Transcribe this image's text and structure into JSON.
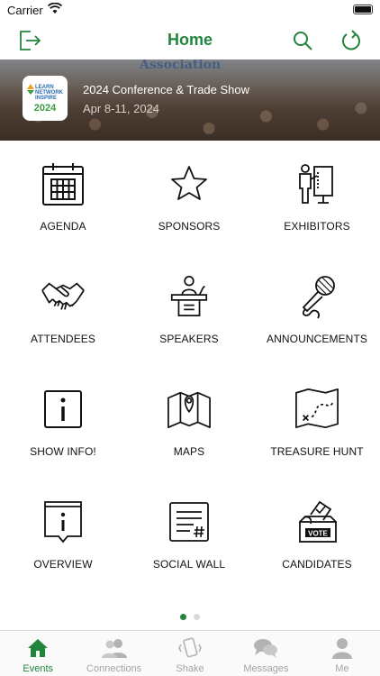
{
  "status": {
    "carrier": "Carrier"
  },
  "nav": {
    "title": "Home"
  },
  "banner": {
    "background_text": "Association",
    "logo_text_lines": [
      "LEARN",
      "NETWORK",
      "INSPIRE"
    ],
    "logo_year": "2024",
    "event_title": "2024 Conference & Trade Show",
    "event_dates": "Apr 8-11, 2024"
  },
  "tiles": [
    {
      "label": "AGENDA",
      "icon": "calendar-icon"
    },
    {
      "label": "SPONSORS",
      "icon": "star-icon"
    },
    {
      "label": "EXHIBITORS",
      "icon": "exhibitor-booth-icon"
    },
    {
      "label": "ATTENDEES",
      "icon": "handshake-icon"
    },
    {
      "label": "SPEAKERS",
      "icon": "podium-icon"
    },
    {
      "label": "ANNOUNCEMENTS",
      "icon": "microphone-icon"
    },
    {
      "label": "SHOW INFO!",
      "icon": "info-icon"
    },
    {
      "label": "MAPS",
      "icon": "map-icon"
    },
    {
      "label": "TREASURE HUNT",
      "icon": "treasure-map-icon"
    },
    {
      "label": "OVERVIEW",
      "icon": "info-note-icon"
    },
    {
      "label": "SOCIAL WALL",
      "icon": "social-wall-icon"
    },
    {
      "label": "CANDIDATES",
      "icon": "ballot-box-icon"
    }
  ],
  "pager": {
    "pages": 2,
    "current": 1
  },
  "tabs": [
    {
      "label": "Events",
      "icon": "home-icon",
      "active": true
    },
    {
      "label": "Connections",
      "icon": "people-icon",
      "active": false
    },
    {
      "label": "Shake",
      "icon": "phone-shake-icon",
      "active": false
    },
    {
      "label": "Messages",
      "icon": "chat-bubbles-icon",
      "active": false
    },
    {
      "label": "Me",
      "icon": "person-icon",
      "active": false
    }
  ],
  "colors": {
    "accent": "#23853d",
    "inactive_tab": "#a3a3a3"
  }
}
